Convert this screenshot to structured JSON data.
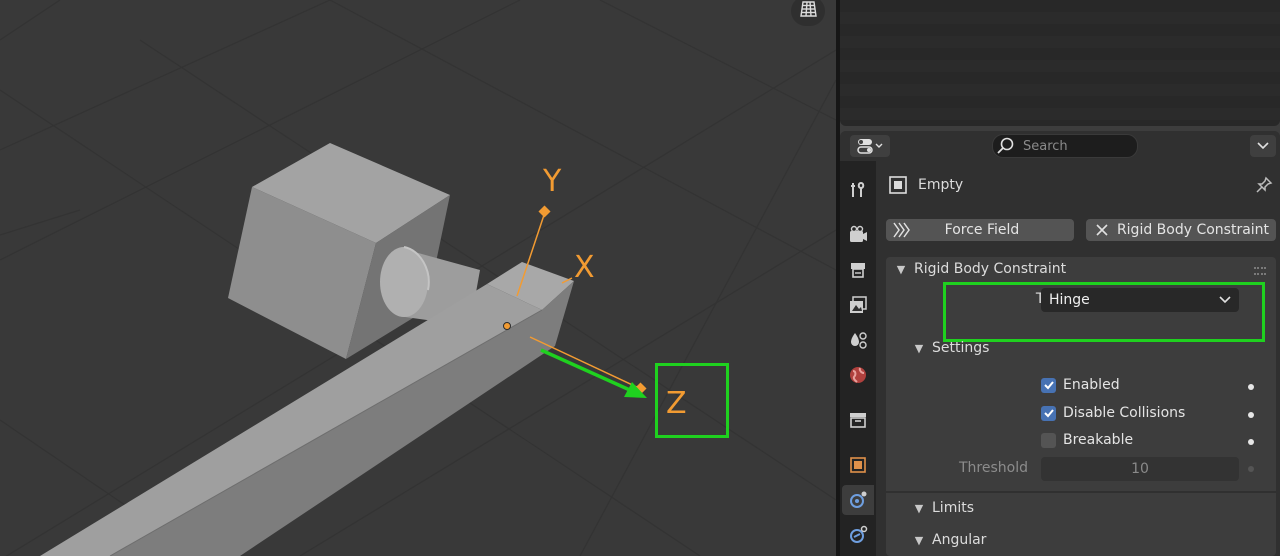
{
  "viewport": {
    "axis_labels": {
      "y": "Y",
      "x": "X",
      "z": "Z"
    },
    "icons": {
      "overlay_grid": "grid-icon"
    },
    "colors": {
      "axis": "#f29b32",
      "annotation": "#1fd11f"
    }
  },
  "properties": {
    "search": {
      "placeholder": "Search",
      "value": ""
    },
    "object_name": "Empty",
    "buttons": {
      "force_field": "Force Field",
      "rigid_body_constraint": "Rigid Body Constraint"
    },
    "panel": {
      "title": "Rigid Body Constraint",
      "type_label": "Type",
      "type_value": "Hinge",
      "settings": {
        "title": "Settings",
        "enabled": {
          "label": "Enabled",
          "checked": true
        },
        "disable_collisions": {
          "label": "Disable Collisions",
          "checked": true
        },
        "breakable": {
          "label": "Breakable",
          "checked": false
        },
        "threshold": {
          "label": "Threshold",
          "value": "10"
        }
      },
      "limits": {
        "title": "Limits"
      },
      "angular": {
        "title": "Angular"
      }
    },
    "tabs": [
      "tool",
      "render",
      "output",
      "view-layer",
      "scene",
      "world",
      "collection",
      "object",
      "physics",
      "constraints"
    ],
    "accent": "#4772b3"
  }
}
